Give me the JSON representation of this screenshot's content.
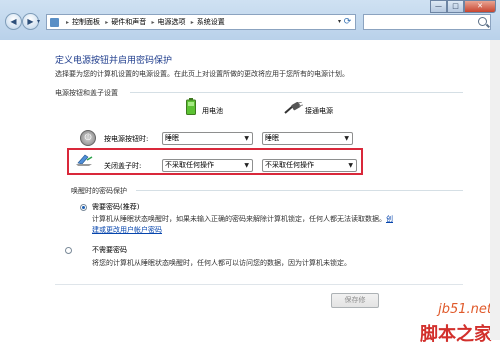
{
  "titlebar": {
    "breadcrumb": [
      "控制面板",
      "硬件和声音",
      "电源选项",
      "系统设置"
    ],
    "search_placeholder": "",
    "window_buttons": {
      "minimize": "—",
      "maximize": "□",
      "close": "✕"
    }
  },
  "page": {
    "title": "定义电源按钮并启用密码保护",
    "description": "选择要为您的计算机设置的电源设置。在此页上对设置所做的更改将应用于您所有的电源计划。"
  },
  "power_section": {
    "title": "电源按钮和盖子设置",
    "columns": [
      "用电池",
      "接通电源"
    ],
    "rows": [
      {
        "label": "按电源按钮时:",
        "battery": "睡眠",
        "plugged": "睡眠"
      },
      {
        "label": "关闭盖子时:",
        "battery": "不采取任何操作",
        "plugged": "不采取任何操作"
      }
    ]
  },
  "password_section": {
    "title": "唤醒时的密码保护",
    "options": [
      {
        "label": "需要密码(推荐)",
        "selected": true,
        "desc_line1": "计算机从睡眠状态唤醒时，如果未输入正确的密码来解除计算机锁定，任何人都无法读取数据。",
        "link_part1": "创",
        "link_part2": "建或更改用户帐户密码"
      },
      {
        "label": "不需要密码",
        "selected": false,
        "desc_line1": "将您的计算机从睡眠状态唤醒时，任何人都可以访问您的数据，因为计算机未锁定。"
      }
    ]
  },
  "footer": {
    "save_label": "保存修"
  },
  "watermark": {
    "line1": "jb51.net",
    "line2": "脚本之家"
  },
  "colors": {
    "highlight_border": "#d9283a",
    "title_blue": "#1e3c8c",
    "link": "#0645ad"
  }
}
